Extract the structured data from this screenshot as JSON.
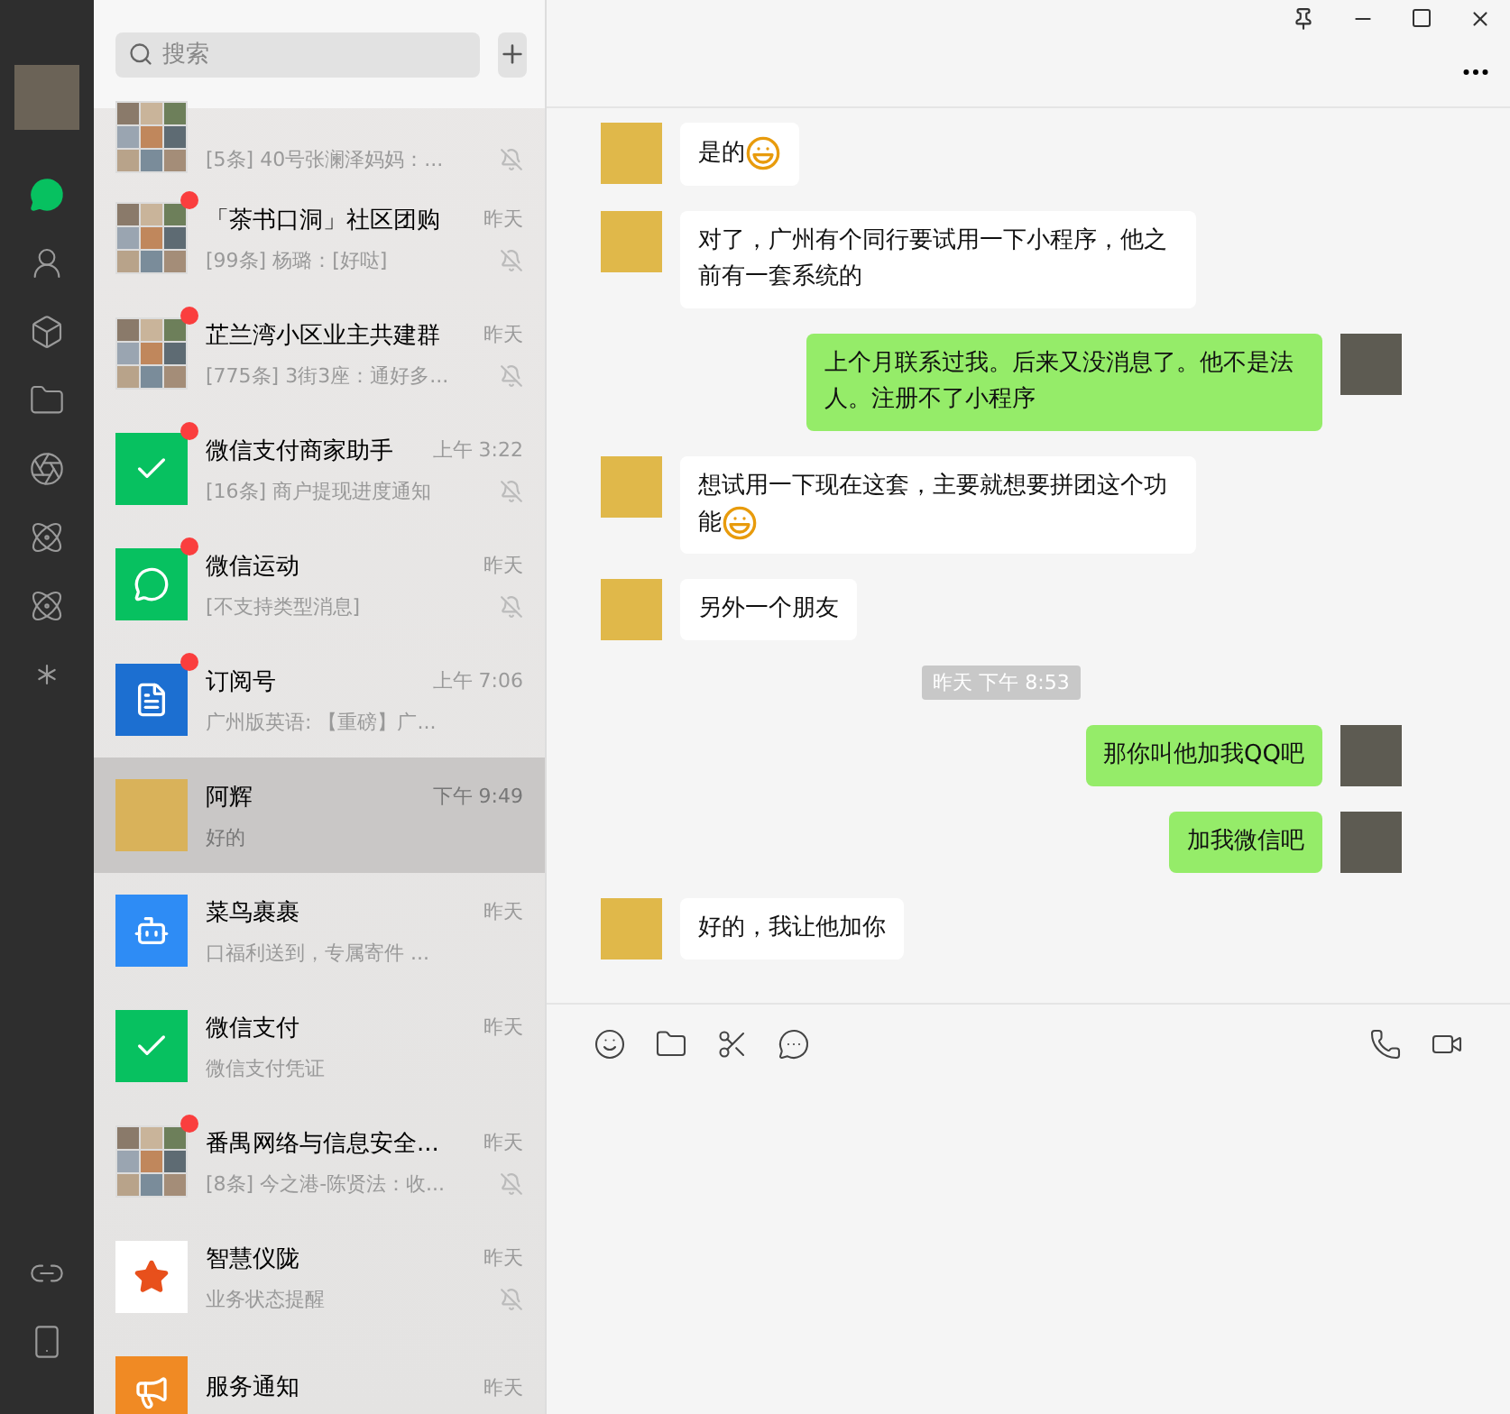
{
  "nav": {
    "items": [
      {
        "kind": "chat",
        "selected": true
      },
      {
        "kind": "contacts",
        "selected": false
      },
      {
        "kind": "favorites",
        "selected": false
      },
      {
        "kind": "files",
        "selected": false
      },
      {
        "kind": "moments",
        "selected": false
      },
      {
        "kind": "channels",
        "selected": false
      },
      {
        "kind": "discover",
        "selected": false
      },
      {
        "kind": "miniprograms",
        "selected": false
      }
    ],
    "bottom": [
      {
        "kind": "link"
      },
      {
        "kind": "phone"
      }
    ]
  },
  "search": {
    "placeholder": "搜索"
  },
  "chats": [
    {
      "preview": "[5条] 40号张澜泽妈妈：...",
      "avatar": {
        "kind": "group"
      },
      "unread": false,
      "muted": true,
      "selected": false,
      "clipped": true
    },
    {
      "name": "「茶书口洞」社区团购",
      "preview": "[99条] 杨璐：[好哒]",
      "time": "昨天",
      "avatar": {
        "kind": "group"
      },
      "unread": true,
      "muted": true,
      "selected": false,
      "clipped": false
    },
    {
      "name": "芷兰湾小区业主共建群",
      "preview": "[775条] 3街3座：通好多...",
      "time": "昨天",
      "avatar": {
        "kind": "group"
      },
      "unread": true,
      "muted": true,
      "selected": false,
      "clipped": false
    },
    {
      "name": "微信支付商家助手",
      "preview": "[16条] 商户提现进度通知",
      "time": "上午 3:22",
      "avatar": {
        "kind": "merchant"
      },
      "unread": true,
      "muted": true,
      "selected": false,
      "clipped": false
    },
    {
      "name": "微信运动",
      "preview": "[不支持类型消息]",
      "time": "昨天",
      "avatar": {
        "kind": "sport"
      },
      "unread": true,
      "muted": true,
      "selected": false,
      "clipped": false
    },
    {
      "name": "订阅号",
      "preview": "广州版英语: 【重磅】广...",
      "time": "上午 7:06",
      "avatar": {
        "kind": "subscription"
      },
      "unread": true,
      "muted": false,
      "selected": false,
      "clipped": false
    },
    {
      "name": "阿辉",
      "preview": "好的",
      "time": "下午 9:49",
      "avatar": {
        "kind": "photo"
      },
      "unread": false,
      "muted": false,
      "selected": true,
      "clipped": false
    },
    {
      "name": "菜鸟裹裹",
      "preview": "口福利送到，专属寄件 ...",
      "time": "昨天",
      "avatar": {
        "kind": "robot"
      },
      "unread": false,
      "muted": false,
      "selected": false,
      "clipped": false
    },
    {
      "name": "微信支付",
      "preview": "微信支付凭证",
      "time": "昨天",
      "avatar": {
        "kind": "pay"
      },
      "unread": false,
      "muted": false,
      "selected": false,
      "clipped": false
    },
    {
      "name": "番禺网络与信息安全...",
      "preview": "[8条] 今之港-陈贤法：收...",
      "time": "昨天",
      "avatar": {
        "kind": "group"
      },
      "unread": true,
      "muted": true,
      "selected": false,
      "clipped": false
    },
    {
      "name": "智慧仪陇",
      "preview": "业务状态提醒",
      "time": "昨天",
      "avatar": {
        "kind": "logo"
      },
      "unread": false,
      "muted": true,
      "selected": false,
      "clipped": false
    },
    {
      "name": "服务通知",
      "time": "昨天",
      "avatar": {
        "kind": "notice"
      },
      "unread": false,
      "muted": false,
      "selected": false,
      "clipped": false
    }
  ],
  "messages": [
    {
      "kind": "them",
      "text": "是的",
      "emoji": true
    },
    {
      "kind": "them",
      "text": "对了，广州有个同行要试用一下小程序，他之前有一套系统的"
    },
    {
      "kind": "me",
      "text": "上个月联系过我。后来又没消息了。他不是法人。注册不了小程序"
    },
    {
      "kind": "them",
      "text": "想试用一下现在这套，主要就想要拼团这个功能",
      "emoji": true
    },
    {
      "kind": "them",
      "text": "另外一个朋友"
    },
    {
      "kind": "time",
      "text": "昨天 下午 8:53"
    },
    {
      "kind": "me",
      "text": "那你叫他加我QQ吧"
    },
    {
      "kind": "me",
      "text": "加我微信吧"
    },
    {
      "kind": "them",
      "text": "好的，我让他加你"
    }
  ]
}
